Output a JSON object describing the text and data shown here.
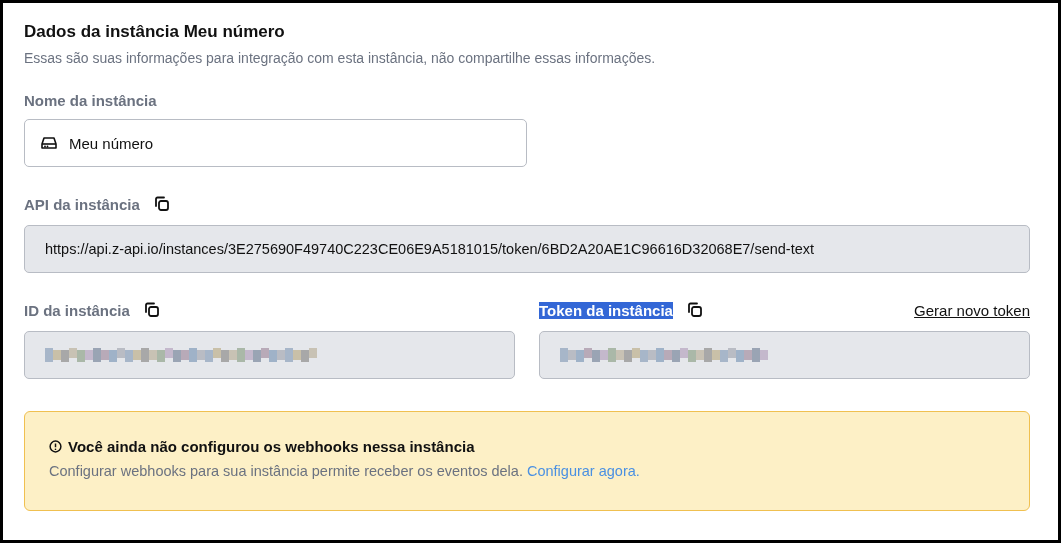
{
  "header": {
    "title": "Dados da instância Meu número",
    "subtitle": "Essas são suas informações para integração com esta instância, não compartilhe essas informações."
  },
  "name_field": {
    "label": "Nome da instância",
    "value": "Meu número"
  },
  "api_field": {
    "label": "API da instância",
    "highlighted": false,
    "value": "https://api.z-api.io/instances/3E275690F49740C223CE06E9A5181015/token/6BD2A20AE1C96616D32068E7/send-text"
  },
  "id_field": {
    "label": "ID da instância",
    "highlighted": false
  },
  "token_field": {
    "label": "Token da instância",
    "highlighted": true,
    "link": "Gerar novo token"
  },
  "alert": {
    "title": "Você ainda não configurou os webhooks nessa instância",
    "text": "Configurar webhooks para sua instância permite receber os eventos dela.",
    "link": "Configurar agora."
  }
}
